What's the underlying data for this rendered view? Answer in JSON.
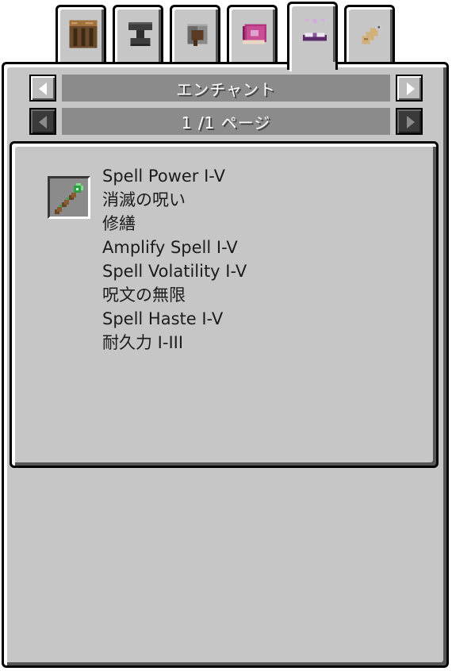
{
  "tabs": [
    {
      "icon": "crafting-table-icon",
      "active": false
    },
    {
      "icon": "anvil-icon",
      "active": false
    },
    {
      "icon": "grindstone-icon",
      "active": false
    },
    {
      "icon": "enchanted-book-icon",
      "active": false
    },
    {
      "icon": "enchanting-table-icon",
      "active": true
    },
    {
      "icon": "name-tag-icon",
      "active": false
    }
  ],
  "header": {
    "title": "エンチャント",
    "page_indicator": "1 /1 ページ"
  },
  "item": {
    "icon": "magic-staff-icon"
  },
  "enchantments": [
    "Spell Power I-V",
    "消滅の呪い",
    "修繕",
    "Amplify Spell I-V",
    "Spell Volatility I-V",
    "呪文の無限",
    "Spell Haste I-V",
    "耐久力 I-III"
  ],
  "colors": {
    "panel": "#c6c6c6",
    "bar": "#8b8b8b",
    "text": "#1c1c1c",
    "bar_text": "#ffffff"
  }
}
